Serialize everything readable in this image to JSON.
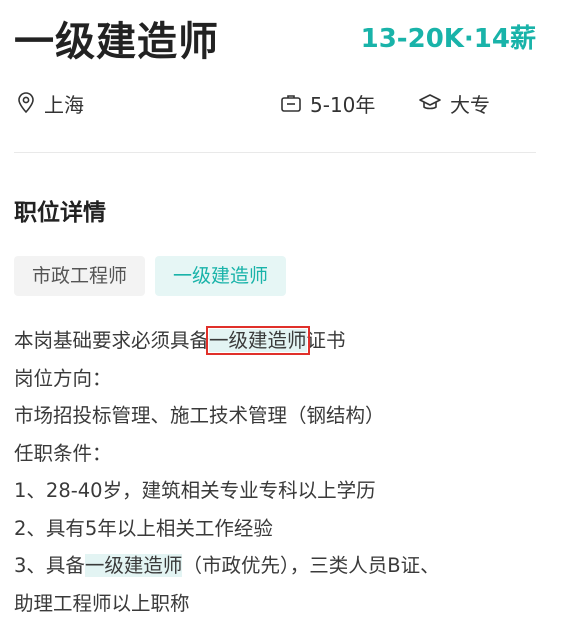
{
  "job": {
    "title": "一级建造师",
    "salary": "13-20K·14薪",
    "location": "上海",
    "experience": "5-10年",
    "education": "大专"
  },
  "icons": {
    "location": "location-pin-icon",
    "experience": "briefcase-icon",
    "education": "graduation-cap-icon"
  },
  "section_title": "职位详情",
  "tags": [
    "市政工程师",
    "一级建造师"
  ],
  "description": {
    "line1": {
      "before": "本岗基础要求必须具备",
      "highlight": "一级建造师",
      "after": "证书"
    },
    "line2": "岗位方向：",
    "line3": "市场招投标管理、施工技术管理（钢结构）",
    "line4": "任职条件：",
    "line5": "1、28-40岁，建筑相关专业专科以上学历",
    "line6": "2、具有5年以上相关工作经验",
    "line7": {
      "before": "3、具备",
      "highlight": "一级建造师",
      "after": "（市政优先），三类人员B证、"
    },
    "line8": "助理工程师以上职称"
  },
  "colors": {
    "accent": "#19b3a9",
    "highlight_bg": "#e3f4f3",
    "annotation_box": "#e0302a"
  }
}
